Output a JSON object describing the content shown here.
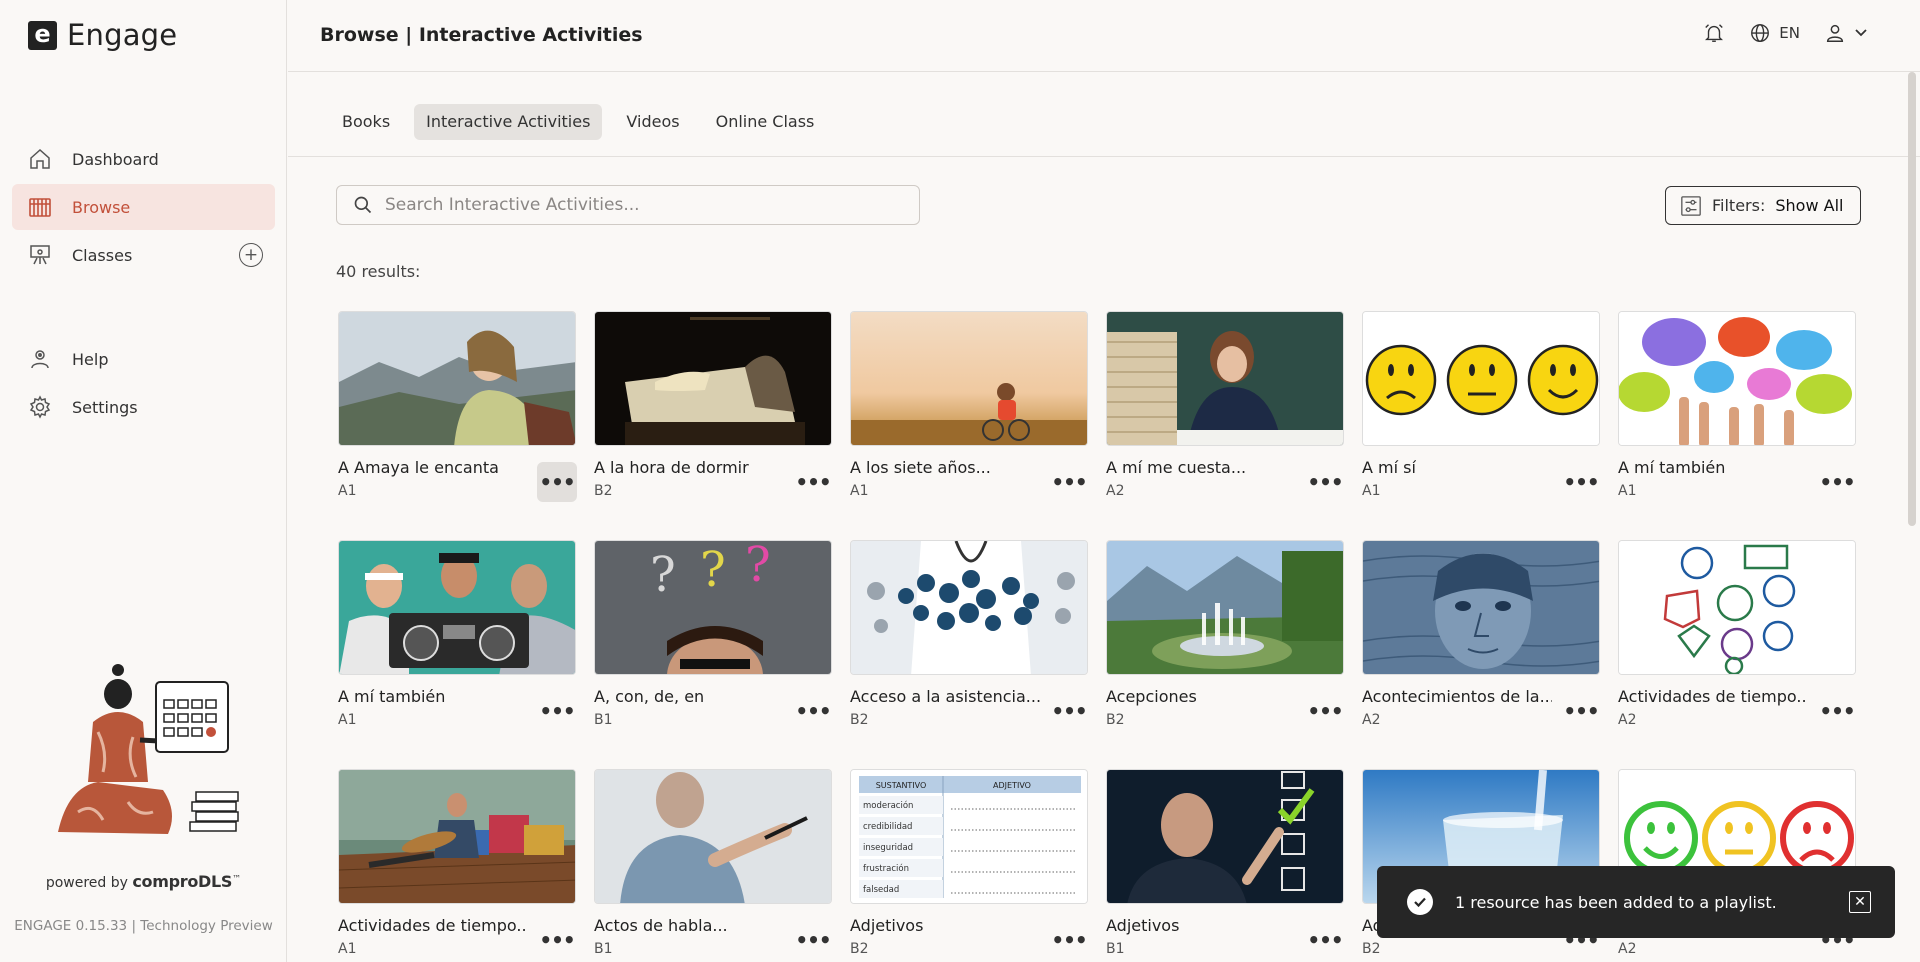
{
  "app": {
    "brand_letter": "e",
    "brand_name": "Engage"
  },
  "sidebar": {
    "items": [
      {
        "label": "Dashboard",
        "icon": "home-icon"
      },
      {
        "label": "Browse",
        "icon": "library-icon"
      },
      {
        "label": "Classes",
        "icon": "classroom-icon"
      },
      {
        "label": "Help",
        "icon": "help-icon"
      },
      {
        "label": "Settings",
        "icon": "gear-icon"
      }
    ],
    "powered_prefix": "powered by",
    "powered_brand": "comproDLS",
    "powered_tm": "™",
    "version": "ENGAGE 0.15.33 | Technology Preview"
  },
  "header": {
    "title": "Browse | Interactive Activities",
    "language": "EN"
  },
  "tabs": [
    {
      "label": "Books"
    },
    {
      "label": "Interactive Activities",
      "active": true
    },
    {
      "label": "Videos"
    },
    {
      "label": "Online Class"
    }
  ],
  "search": {
    "placeholder": "Search Interactive Activities...",
    "value": ""
  },
  "filters": {
    "label": "Filters:",
    "value": "Show All"
  },
  "results_text": "40 results:",
  "cards": [
    {
      "title": "A Amaya le encanta",
      "level": "A1"
    },
    {
      "title": "A la hora de dormir",
      "level": "B2"
    },
    {
      "title": "A los siete años...",
      "level": "A1"
    },
    {
      "title": "A mí me cuesta...",
      "level": "A2"
    },
    {
      "title": "A mí sí",
      "level": "A1"
    },
    {
      "title": "A mí también",
      "level": "A1"
    },
    {
      "title": "A mí también",
      "level": "A1"
    },
    {
      "title": "A, con, de, en",
      "level": "B1"
    },
    {
      "title": "Acceso a la asistencia...",
      "level": "B2"
    },
    {
      "title": "Acepciones",
      "level": "B2"
    },
    {
      "title": "Acontecimientos de la...",
      "level": "A2"
    },
    {
      "title": "Actividades de tiempo...",
      "level": "A2"
    },
    {
      "title": "Actividades de tiempo...",
      "level": "A1"
    },
    {
      "title": "Actos de habla...",
      "level": "B1"
    },
    {
      "title": "Adjetivos",
      "level": "B2"
    },
    {
      "title": "Adjetivos",
      "level": "B1"
    },
    {
      "title": "Ad...",
      "level": "B2"
    },
    {
      "title": "",
      "level": "A2"
    }
  ],
  "table_thumb": {
    "headers": [
      "SUSTANTIVO",
      "ADJETIVO"
    ],
    "rows": [
      "moderación",
      "credibilidad",
      "inseguridad",
      "frustración",
      "falsedad"
    ]
  },
  "toast": {
    "message": "1 resource has been added to a playlist."
  },
  "colors": {
    "accent": "#c2503a",
    "active_bg": "#f7e4e0",
    "toast_bg": "#262626"
  }
}
